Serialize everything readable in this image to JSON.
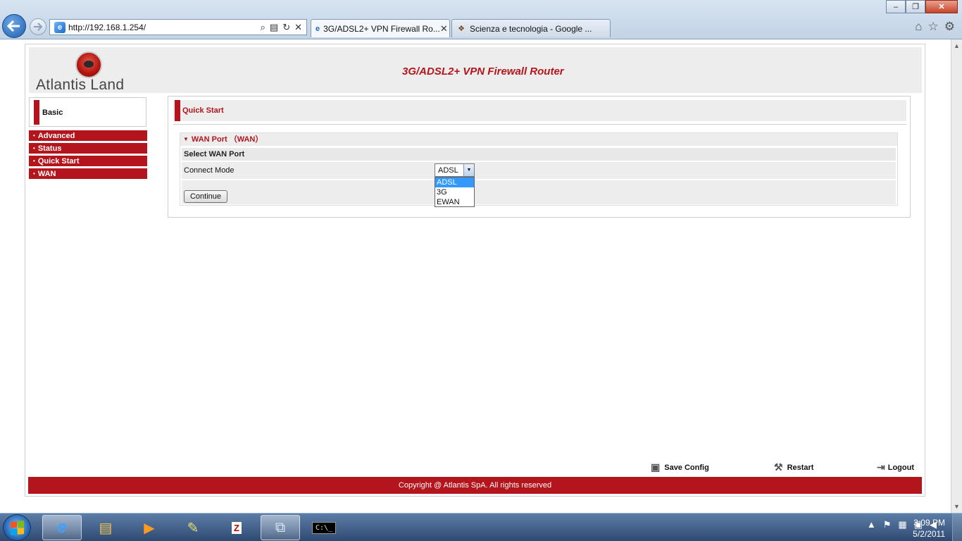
{
  "browser": {
    "address": "http://192.168.1.254/",
    "tabs": [
      {
        "label": "3G/ADSL2+ VPN Firewall Ro...",
        "active": true
      },
      {
        "label": "Scienza e tecnologia - Google ...",
        "active": false
      }
    ],
    "window_controls": {
      "minimize": "–",
      "maximize": "❐",
      "close": "✕"
    }
  },
  "page": {
    "logo_text": "Atlantis Land",
    "header_title": "3G/ADSL2+ VPN Firewall Router",
    "menu": {
      "basic": "Basic",
      "items": [
        "Advanced",
        "Status",
        "Quick Start",
        "WAN"
      ]
    },
    "section_title": "Quick Start",
    "panel_title": "WAN Port （WAN）",
    "select_wan_port": "Select WAN Port",
    "connect_mode_label": "Connect Mode",
    "connect_mode_value": "ADSL",
    "connect_mode_options": [
      "ADSL",
      "3G",
      "EWAN"
    ],
    "continue_label": "Continue",
    "footer": {
      "save_config": "Save Config",
      "restart": "Restart",
      "logout": "Logout",
      "copyright": "Copyright @ Atlantis SpA. All rights reserved"
    }
  },
  "taskbar": {
    "time": "3:09 PM",
    "date": "5/2/2011"
  },
  "colors": {
    "brand_red": "#b4141b",
    "panel_gray": "#ededed"
  }
}
